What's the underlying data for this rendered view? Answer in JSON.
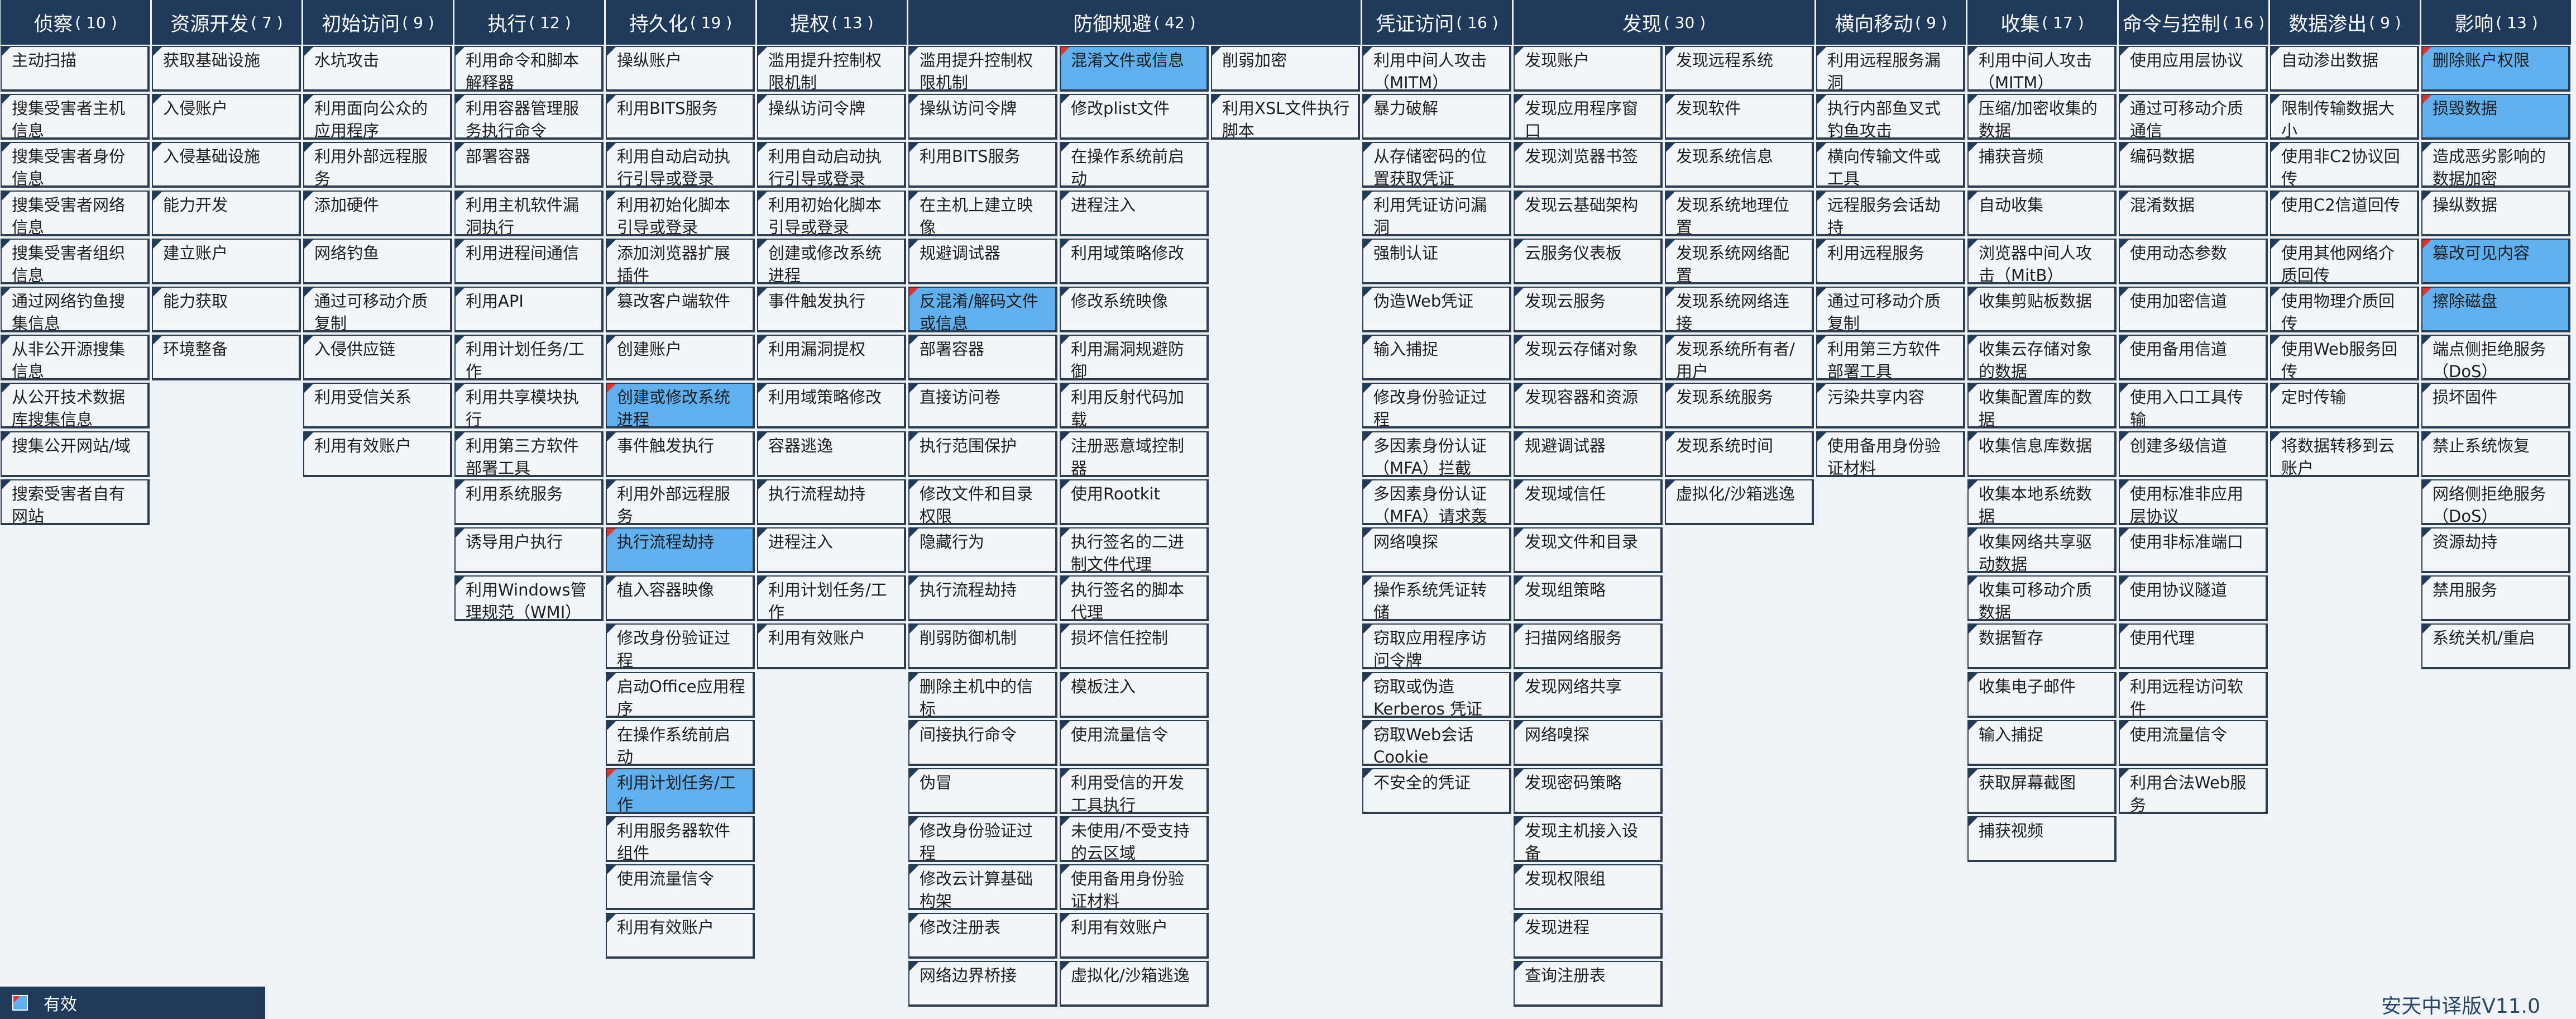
{
  "colors": {
    "header": "#1f3a5a",
    "cell": "#f3f6f9",
    "highlight": "#5fb0ef",
    "marker": "#e5322d",
    "border": "#2e3d4d"
  },
  "legend": {
    "label": "有效",
    "icon": "highlight-swatch-icon"
  },
  "brand": "安天中译版V11.0",
  "tactics": [
    {
      "name": "侦察",
      "count": "( 10 )",
      "columns": [
        [
          {
            "t": "主动扫描"
          },
          {
            "t": "搜集受害者主机信息"
          },
          {
            "t": "搜集受害者身份信息"
          },
          {
            "t": "搜集受害者网络信息"
          },
          {
            "t": "搜集受害者组织信息"
          },
          {
            "t": "通过网络钓鱼搜集信息"
          },
          {
            "t": "从非公开源搜集信息"
          },
          {
            "t": "从公开技术数据库搜集信息"
          },
          {
            "t": "搜集公开网站/域"
          },
          {
            "t": "搜索受害者自有网站"
          }
        ]
      ]
    },
    {
      "name": "资源开发",
      "count": "( 7 )",
      "columns": [
        [
          {
            "t": "获取基础设施"
          },
          {
            "t": "入侵账户"
          },
          {
            "t": "入侵基础设施"
          },
          {
            "t": "能力开发"
          },
          {
            "t": "建立账户"
          },
          {
            "t": "能力获取"
          },
          {
            "t": "环境整备"
          }
        ]
      ]
    },
    {
      "name": "初始访问",
      "count": "( 9 )",
      "columns": [
        [
          {
            "t": "水坑攻击"
          },
          {
            "t": "利用面向公众的应用程序"
          },
          {
            "t": "利用外部远程服务"
          },
          {
            "t": "添加硬件"
          },
          {
            "t": "网络钓鱼"
          },
          {
            "t": "通过可移动介质复制"
          },
          {
            "t": "入侵供应链"
          },
          {
            "t": "利用受信关系"
          },
          {
            "t": "利用有效账户"
          }
        ]
      ]
    },
    {
      "name": "执行",
      "count": "( 12 )",
      "columns": [
        [
          {
            "t": "利用命令和脚本解释器"
          },
          {
            "t": "利用容器管理服务执行命令"
          },
          {
            "t": "部署容器"
          },
          {
            "t": "利用主机软件漏洞执行"
          },
          {
            "t": "利用进程间通信"
          },
          {
            "t": "利用API"
          },
          {
            "t": "利用计划任务/工作"
          },
          {
            "t": "利用共享模块执行"
          },
          {
            "t": "利用第三方软件部署工具"
          },
          {
            "t": "利用系统服务"
          },
          {
            "t": "诱导用户执行"
          },
          {
            "t": "利用Windows管理规范（WMI）"
          }
        ]
      ]
    },
    {
      "name": "持久化",
      "count": "( 19 )",
      "columns": [
        [
          {
            "t": "操纵账户"
          },
          {
            "t": "利用BITS服务"
          },
          {
            "t": "利用自动启动执行引导或登录"
          },
          {
            "t": "利用初始化脚本引导或登录"
          },
          {
            "t": "添加浏览器扩展插件"
          },
          {
            "t": "篡改客户端软件"
          },
          {
            "t": "创建账户"
          },
          {
            "t": "创建或修改系统进程",
            "h": true
          },
          {
            "t": "事件触发执行"
          },
          {
            "t": "利用外部远程服务"
          },
          {
            "t": "执行流程劫持",
            "h": true
          },
          {
            "t": "植入容器映像"
          },
          {
            "t": "修改身份验证过程"
          },
          {
            "t": "启动Office应用程序"
          },
          {
            "t": "在操作系统前启动"
          },
          {
            "t": "利用计划任务/工作",
            "h": true
          },
          {
            "t": "利用服务器软件组件"
          },
          {
            "t": "使用流量信令"
          },
          {
            "t": "利用有效账户"
          }
        ]
      ]
    },
    {
      "name": "提权",
      "count": "( 13 )",
      "columns": [
        [
          {
            "t": "滥用提升控制权限机制"
          },
          {
            "t": "操纵访问令牌"
          },
          {
            "t": "利用自动启动执行引导或登录"
          },
          {
            "t": "利用初始化脚本引导或登录"
          },
          {
            "t": "创建或修改系统进程"
          },
          {
            "t": "事件触发执行"
          },
          {
            "t": "利用漏洞提权"
          },
          {
            "t": "利用域策略修改"
          },
          {
            "t": "容器逃逸"
          },
          {
            "t": "执行流程劫持"
          },
          {
            "t": "进程注入"
          },
          {
            "t": "利用计划任务/工作"
          },
          {
            "t": "利用有效账户"
          }
        ]
      ]
    },
    {
      "name": "防御规避",
      "count": "( 42 )",
      "columns": [
        [
          {
            "t": "滥用提升控制权限机制"
          },
          {
            "t": "操纵访问令牌"
          },
          {
            "t": "利用BITS服务"
          },
          {
            "t": "在主机上建立映像"
          },
          {
            "t": "规避调试器"
          },
          {
            "t": "反混淆/解码文件或信息",
            "h": true
          },
          {
            "t": "部署容器"
          },
          {
            "t": "直接访问卷"
          },
          {
            "t": "执行范围保护"
          },
          {
            "t": "修改文件和目录权限"
          },
          {
            "t": "隐藏行为"
          },
          {
            "t": "执行流程劫持"
          },
          {
            "t": "削弱防御机制"
          },
          {
            "t": "删除主机中的信标"
          },
          {
            "t": "间接执行命令"
          },
          {
            "t": "伪冒"
          },
          {
            "t": "修改身份验证过程"
          },
          {
            "t": "修改云计算基础构架"
          },
          {
            "t": "修改注册表"
          },
          {
            "t": "网络边界桥接"
          }
        ],
        [
          {
            "t": "混淆文件或信息",
            "h": true
          },
          {
            "t": "修改plist文件"
          },
          {
            "t": "在操作系统前启动"
          },
          {
            "t": "进程注入"
          },
          {
            "t": "利用域策略修改"
          },
          {
            "t": "修改系统映像"
          },
          {
            "t": "利用漏洞规避防御"
          },
          {
            "t": "利用反射代码加载"
          },
          {
            "t": "注册恶意域控制器"
          },
          {
            "t": "使用Rootkit"
          },
          {
            "t": "执行签名的二进制文件代理"
          },
          {
            "t": "执行签名的脚本代理"
          },
          {
            "t": "损坏信任控制"
          },
          {
            "t": "模板注入"
          },
          {
            "t": "使用流量信令"
          },
          {
            "t": "利用受信的开发工具执行"
          },
          {
            "t": "未使用/不受支持的云区域"
          },
          {
            "t": "使用备用身份验证材料"
          },
          {
            "t": "利用有效账户"
          },
          {
            "t": "虚拟化/沙箱逃逸"
          }
        ],
        [
          {
            "t": "削弱加密"
          },
          {
            "t": "利用XSL文件执行脚本"
          }
        ]
      ]
    },
    {
      "name": "凭证访问",
      "count": "( 16 )",
      "columns": [
        [
          {
            "t": "利用中间人攻击（MITM）"
          },
          {
            "t": "暴力破解"
          },
          {
            "t": "从存储密码的位置获取凭证"
          },
          {
            "t": "利用凭证访问漏洞"
          },
          {
            "t": "强制认证"
          },
          {
            "t": "伪造Web凭证"
          },
          {
            "t": "输入捕捉"
          },
          {
            "t": "修改身份验证过程"
          },
          {
            "t": "多因素身份认证（MFA）拦截"
          },
          {
            "t": "多因素身份认证（MFA）请求轰炸"
          },
          {
            "t": "网络嗅探"
          },
          {
            "t": "操作系统凭证转储"
          },
          {
            "t": "窃取应用程序访问令牌"
          },
          {
            "t": "窃取或伪造Kerberos 凭证"
          },
          {
            "t": "窃取Web会话Cookie"
          },
          {
            "t": "不安全的凭证"
          }
        ]
      ]
    },
    {
      "name": "发现",
      "count": "( 30 )",
      "columns": [
        [
          {
            "t": "发现账户"
          },
          {
            "t": "发现应用程序窗口"
          },
          {
            "t": "发现浏览器书签"
          },
          {
            "t": "发现云基础架构"
          },
          {
            "t": "云服务仪表板"
          },
          {
            "t": "发现云服务"
          },
          {
            "t": "发现云存储对象"
          },
          {
            "t": "发现容器和资源"
          },
          {
            "t": "规避调试器"
          },
          {
            "t": "发现域信任"
          },
          {
            "t": "发现文件和目录"
          },
          {
            "t": "发现组策略"
          },
          {
            "t": "扫描网络服务"
          },
          {
            "t": "发现网络共享"
          },
          {
            "t": "网络嗅探"
          },
          {
            "t": "发现密码策略"
          },
          {
            "t": "发现主机接入设备"
          },
          {
            "t": "发现权限组"
          },
          {
            "t": "发现进程"
          },
          {
            "t": "查询注册表"
          }
        ],
        [
          {
            "t": "发现远程系统"
          },
          {
            "t": "发现软件"
          },
          {
            "t": "发现系统信息"
          },
          {
            "t": "发现系统地理位置"
          },
          {
            "t": "发现系统网络配置"
          },
          {
            "t": "发现系统网络连接"
          },
          {
            "t": "发现系统所有者/用户"
          },
          {
            "t": "发现系统服务"
          },
          {
            "t": "发现系统时间"
          },
          {
            "t": "虚拟化/沙箱逃逸"
          }
        ]
      ]
    },
    {
      "name": "横向移动",
      "count": "( 9 )",
      "columns": [
        [
          {
            "t": "利用远程服务漏洞"
          },
          {
            "t": "执行内部鱼叉式钓鱼攻击"
          },
          {
            "t": "横向传输文件或工具"
          },
          {
            "t": "远程服务会话劫持"
          },
          {
            "t": "利用远程服务"
          },
          {
            "t": "通过可移动介质复制"
          },
          {
            "t": "利用第三方软件部署工具"
          },
          {
            "t": "污染共享内容"
          },
          {
            "t": "使用备用身份验证材料"
          }
        ]
      ]
    },
    {
      "name": "收集",
      "count": "( 17 )",
      "columns": [
        [
          {
            "t": "利用中间人攻击（MITM）"
          },
          {
            "t": "压缩/加密收集的数据"
          },
          {
            "t": "捕获音频"
          },
          {
            "t": "自动收集"
          },
          {
            "t": "浏览器中间人攻击（MitB）"
          },
          {
            "t": "收集剪贴板数据"
          },
          {
            "t": "收集云存储对象的数据"
          },
          {
            "t": "收集配置库的数据"
          },
          {
            "t": "收集信息库数据"
          },
          {
            "t": "收集本地系统数据"
          },
          {
            "t": "收集网络共享驱动数据"
          },
          {
            "t": "收集可移动介质数据"
          },
          {
            "t": "数据暂存"
          },
          {
            "t": "收集电子邮件"
          },
          {
            "t": "输入捕捉"
          },
          {
            "t": "获取屏幕截图"
          },
          {
            "t": "捕获视频"
          }
        ]
      ]
    },
    {
      "name": "命令与控制",
      "count": "( 16 )",
      "columns": [
        [
          {
            "t": "使用应用层协议"
          },
          {
            "t": "通过可移动介质通信"
          },
          {
            "t": "编码数据"
          },
          {
            "t": "混淆数据"
          },
          {
            "t": "使用动态参数"
          },
          {
            "t": "使用加密信道"
          },
          {
            "t": "使用备用信道"
          },
          {
            "t": "使用入口工具传输"
          },
          {
            "t": "创建多级信道"
          },
          {
            "t": "使用标准非应用层协议"
          },
          {
            "t": "使用非标准端口"
          },
          {
            "t": "使用协议隧道"
          },
          {
            "t": "使用代理"
          },
          {
            "t": "利用远程访问软件"
          },
          {
            "t": "使用流量信令"
          },
          {
            "t": "利用合法Web服务"
          }
        ]
      ]
    },
    {
      "name": "数据渗出",
      "count": "( 9 )",
      "columns": [
        [
          {
            "t": "自动渗出数据"
          },
          {
            "t": "限制传输数据大小"
          },
          {
            "t": "使用非C2协议回传"
          },
          {
            "t": "使用C2信道回传"
          },
          {
            "t": "使用其他网络介质回传"
          },
          {
            "t": "使用物理介质回传"
          },
          {
            "t": "使用Web服务回传"
          },
          {
            "t": "定时传输"
          },
          {
            "t": "将数据转移到云账户"
          }
        ]
      ]
    },
    {
      "name": "影响",
      "count": "( 13 )",
      "columns": [
        [
          {
            "t": "删除账户权限",
            "h": true
          },
          {
            "t": "损毁数据",
            "h": true
          },
          {
            "t": "造成恶劣影响的数据加密"
          },
          {
            "t": "操纵数据"
          },
          {
            "t": "篡改可见内容",
            "h": true
          },
          {
            "t": "擦除磁盘",
            "h": true
          },
          {
            "t": "端点侧拒绝服务（DoS）"
          },
          {
            "t": "损坏固件"
          },
          {
            "t": "禁止系统恢复"
          },
          {
            "t": "网络侧拒绝服务（DoS）"
          },
          {
            "t": "资源劫持"
          },
          {
            "t": "禁用服务"
          },
          {
            "t": "系统关机/重启"
          }
        ]
      ]
    }
  ]
}
